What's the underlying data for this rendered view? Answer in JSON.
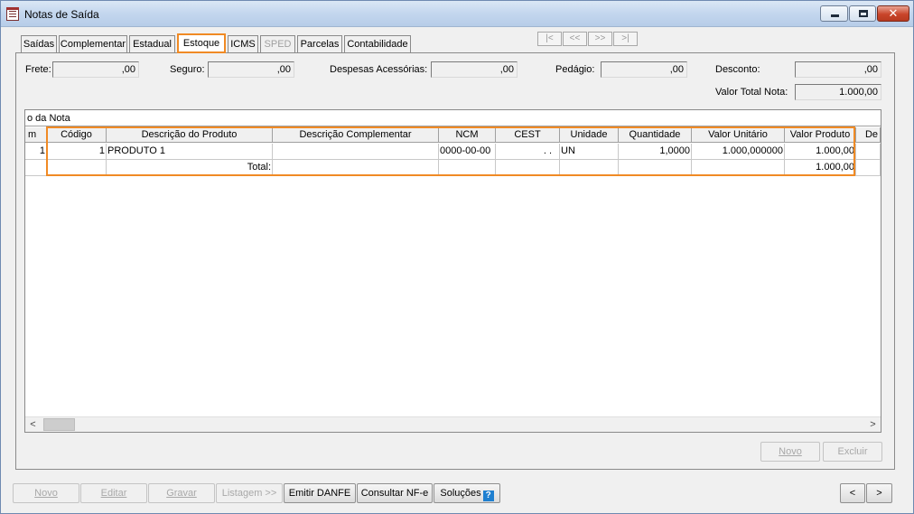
{
  "window": {
    "title": "Notas de Saída",
    "min_label": "",
    "max_label": "",
    "close_label": "✕"
  },
  "tabs": [
    {
      "label": "Saídas",
      "state": "normal"
    },
    {
      "label": "Complementar",
      "state": "normal"
    },
    {
      "label": "Estadual",
      "state": "normal"
    },
    {
      "label": "Estoque",
      "state": "active"
    },
    {
      "label": "ICMS",
      "state": "normal"
    },
    {
      "label": "SPED",
      "state": "disabled"
    },
    {
      "label": "Parcelas",
      "state": "normal"
    },
    {
      "label": "Contabilidade",
      "state": "normal"
    }
  ],
  "record_nav": [
    "|<",
    "<<",
    ">>",
    ">|"
  ],
  "totals": {
    "frete_label": "Frete:",
    "frete_value": ",00",
    "seguro_label": "Seguro:",
    "seguro_value": ",00",
    "despesas_label": "Despesas Acessórias:",
    "despesas_value": ",00",
    "pedagio_label": "Pedágio:",
    "pedagio_value": ",00",
    "desconto_label": "Desconto:",
    "desconto_value": ",00",
    "valor_total_label": "Valor Total Nota:",
    "valor_total_value": "1.000,00"
  },
  "grid": {
    "caption": "o da Nota",
    "columns": [
      "m",
      "Código",
      "Descrição do Produto",
      "Descrição Complementar",
      "NCM",
      "CEST",
      "Unidade",
      "Quantidade",
      "Valor Unitário",
      "Valor Produto",
      "De"
    ],
    "rows": [
      [
        "1",
        "1",
        "PRODUTO 1",
        "",
        "0000-00-00",
        ". .",
        "UN",
        "1,0000",
        "1.000,000000",
        "1.000,00",
        ""
      ]
    ],
    "total_label": "Total:",
    "total_value": "1.000,00"
  },
  "panel_buttons": {
    "novo": "Novo",
    "excluir": "Excluir"
  },
  "bottom_buttons": {
    "novo": "Novo",
    "editar": "Editar",
    "gravar": "Gravar",
    "listagem": "Listagem >>",
    "emitir_danfe": "Emitir DANFE",
    "consultar_nfe": "Consultar NF-e",
    "solucoes": "Soluções",
    "help_badge": "?",
    "prev": "<",
    "next": ">"
  },
  "scroll": {
    "left": "<",
    "right": ">"
  }
}
